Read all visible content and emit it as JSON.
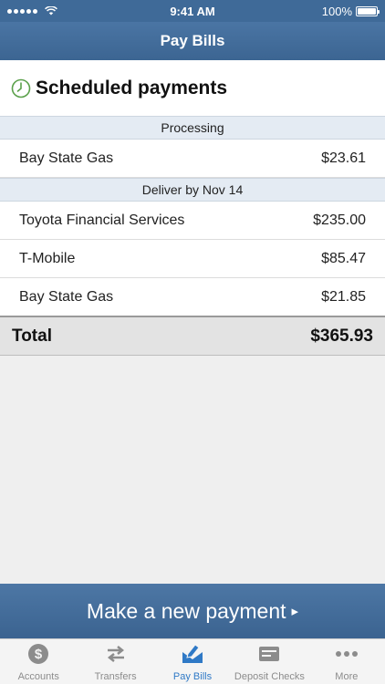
{
  "status_bar": {
    "time": "9:41 AM",
    "battery": "100%"
  },
  "nav": {
    "title": "Pay Bills"
  },
  "header": {
    "title": "Scheduled payments"
  },
  "sections": [
    {
      "label": "Processing",
      "items": [
        {
          "payee": "Bay State Gas",
          "amount": "$23.61"
        }
      ]
    },
    {
      "label": "Deliver by Nov 14",
      "items": [
        {
          "payee": "Toyota Financial Services",
          "amount": "$235.00"
        },
        {
          "payee": "T-Mobile",
          "amount": "$85.47"
        },
        {
          "payee": "Bay State Gas",
          "amount": "$21.85"
        }
      ]
    }
  ],
  "total": {
    "label": "Total",
    "amount": "$365.93"
  },
  "cta": {
    "label": "Make a new payment",
    "arrow": "▸"
  },
  "tabs": [
    {
      "label": "Accounts",
      "icon": "dollar-coin-icon"
    },
    {
      "label": "Transfers",
      "icon": "transfer-arrows-icon"
    },
    {
      "label": "Pay Bills",
      "icon": "envelope-pen-icon",
      "active": true
    },
    {
      "label": "Deposit Checks",
      "icon": "check-card-icon"
    },
    {
      "label": "More",
      "icon": "more-dots-icon"
    }
  ],
  "colors": {
    "brand": "#3f6a98",
    "active_tab": "#2f79c6",
    "clock_green": "#5aa04a"
  }
}
